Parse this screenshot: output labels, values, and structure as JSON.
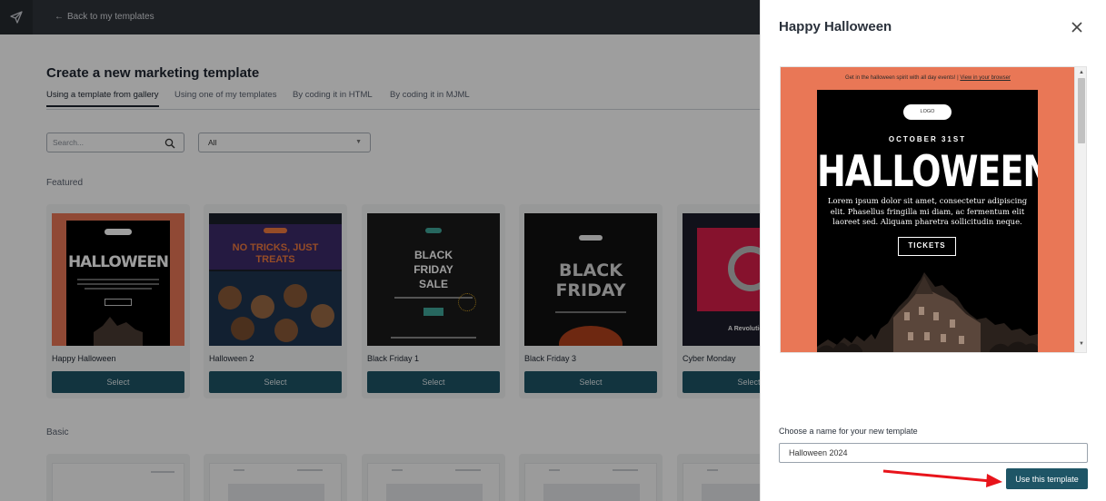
{
  "topbar": {
    "back_label": "Back to my templates",
    "back_arrow": "←"
  },
  "page": {
    "title": "Create a new marketing template",
    "tabs": [
      {
        "label": "Using a template from gallery",
        "active": true
      },
      {
        "label": "Using one of my templates",
        "active": false
      },
      {
        "label": "By coding it in HTML",
        "active": false
      },
      {
        "label": "By coding it in MJML",
        "active": false
      }
    ],
    "search": {
      "placeholder": "Search..."
    },
    "filter": {
      "selected": "All"
    },
    "featured_label": "Featured",
    "basic_label": "Basic"
  },
  "featured": [
    {
      "name": "Happy Halloween",
      "button": "Select",
      "thumb_text": "HALLOWEEN"
    },
    {
      "name": "Halloween 2",
      "button": "Select",
      "thumb_text": "NO TRICKS, JUST TREATS"
    },
    {
      "name": "Black Friday 1",
      "button": "Select",
      "thumb_text": "BLACK FRIDAY SALE"
    },
    {
      "name": "Black Friday 3",
      "button": "Select",
      "thumb_text": "BLACK FRIDAY"
    },
    {
      "name": "Cyber Monday",
      "button": "Select",
      "thumb_text": "A Revolutionary"
    }
  ],
  "panel": {
    "title": "Happy Halloween",
    "preview": {
      "top_text": "Get in the halloween spirit with all day events!",
      "top_link": "View in your browser",
      "logo": "LOGO",
      "date": "OCTOBER 31ST",
      "headline": "HALLOWEEN",
      "body": "Lorem ipsum dolor sit amet, consectetur adipiscing elit. Phasellus fringilla mi diam, ac fermentum elit laoreet sed. Aliquam pharetra sollicitudin neque.",
      "cta": "TICKETS"
    },
    "name_label": "Choose a name for your new template",
    "name_value": "Halloween 2024",
    "use_button": "Use this template"
  },
  "colors": {
    "accent": "#1e5566",
    "topbar": "#30343b",
    "halloween_orange": "#e97756",
    "annotation_arrow": "#e8141b"
  }
}
